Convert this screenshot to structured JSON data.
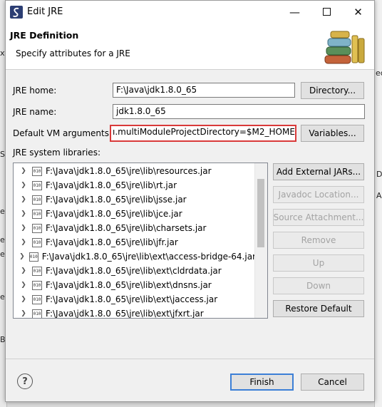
{
  "window": {
    "title": "Edit JRE"
  },
  "header": {
    "title": "JRE Definition",
    "subtitle": "Specify attributes for a JRE"
  },
  "form": {
    "jre_home_label": "JRE home:",
    "jre_home_value": "F:\\Java\\jdk1.8.0_65",
    "directory_button": "Directory...",
    "jre_name_label": "JRE name:",
    "jre_name_value": "jdk1.8.0_65",
    "vm_args_label": "Default VM arguments:",
    "vm_args_value": "ı.multiModuleProjectDirectory=$M2_HOME",
    "variables_button": "Variables...",
    "system_libraries_label": "JRE system libraries:"
  },
  "libraries": [
    "F:\\Java\\jdk1.8.0_65\\jre\\lib\\resources.jar",
    "F:\\Java\\jdk1.8.0_65\\jre\\lib\\rt.jar",
    "F:\\Java\\jdk1.8.0_65\\jre\\lib\\jsse.jar",
    "F:\\Java\\jdk1.8.0_65\\jre\\lib\\jce.jar",
    "F:\\Java\\jdk1.8.0_65\\jre\\lib\\charsets.jar",
    "F:\\Java\\jdk1.8.0_65\\jre\\lib\\jfr.jar",
    "F:\\Java\\jdk1.8.0_65\\jre\\lib\\ext\\access-bridge-64.jar",
    "F:\\Java\\jdk1.8.0_65\\jre\\lib\\ext\\cldrdata.jar",
    "F:\\Java\\jdk1.8.0_65\\jre\\lib\\ext\\dnsns.jar",
    "F:\\Java\\jdk1.8.0_65\\jre\\lib\\ext\\jaccess.jar",
    "F:\\Java\\jdk1.8.0_65\\jre\\lib\\ext\\jfxrt.jar"
  ],
  "side_buttons": {
    "add_external_jars": "Add External JARs...",
    "javadoc_location": "Javadoc Location...",
    "source_attachment": "Source Attachment...",
    "remove": "Remove",
    "up": "Up",
    "down": "Down",
    "restore_default": "Restore Default"
  },
  "footer": {
    "finish": "Finish",
    "cancel": "Cancel"
  },
  "icons": {
    "app": "eclipse-s-icon",
    "minimize": "minimize-icon",
    "maximize": "maximize-icon",
    "close": "close-icon",
    "header": "books-icon",
    "help": "help-icon",
    "jar": "jar-file-icon",
    "expand": "chevron-right-icon"
  },
  "background_fragments": {
    "left": [
      "xt",
      "S",
      "e",
      "er",
      "e",
      "e",
      "Bu"
    ],
    "right": [
      "ec",
      "D",
      "A"
    ]
  },
  "colors": {
    "highlight_border": "#d93a3a",
    "default_button_border": "#3c7fd6"
  }
}
